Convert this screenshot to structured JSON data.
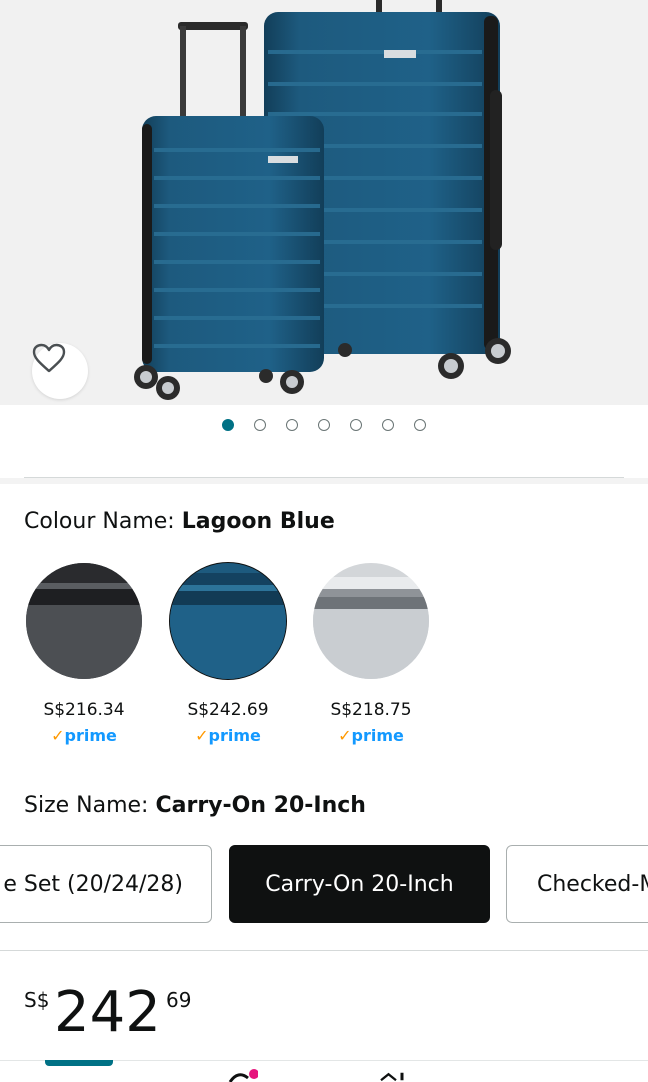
{
  "gallery": {
    "image_count": 7,
    "active_index": 0,
    "wishlist_icon": "heart-icon",
    "luggage_colors": {
      "body": "#1d5a7e",
      "body_dark": "#123e59",
      "rib": "#2a6e93"
    }
  },
  "colour": {
    "label": "Colour Name:",
    "selected": "Lagoon Blue",
    "options": [
      {
        "name": "Black",
        "price": "S$216.34",
        "prime": "prime",
        "color": "#3a3c40"
      },
      {
        "name": "Lagoon Blue",
        "price": "S$242.69",
        "prime": "prime",
        "color": "#1d5a7e"
      },
      {
        "name": "Silver",
        "price": "S$218.75",
        "prime": "prime",
        "color": "#c9cdd1"
      }
    ]
  },
  "size": {
    "label": "Size Name:",
    "selected": "Carry-On 20-Inch",
    "options": [
      {
        "label": "e Set (20/24/28)"
      },
      {
        "label": "Carry-On 20-Inch"
      },
      {
        "label": "Checked-M"
      }
    ]
  },
  "price": {
    "currency": "S$",
    "whole": "242",
    "fraction": "69"
  },
  "colors": {
    "accent": "#007185",
    "prime_blue": "#1399ff",
    "prime_check": "#ff9900",
    "selected_button": "#0f1111"
  }
}
